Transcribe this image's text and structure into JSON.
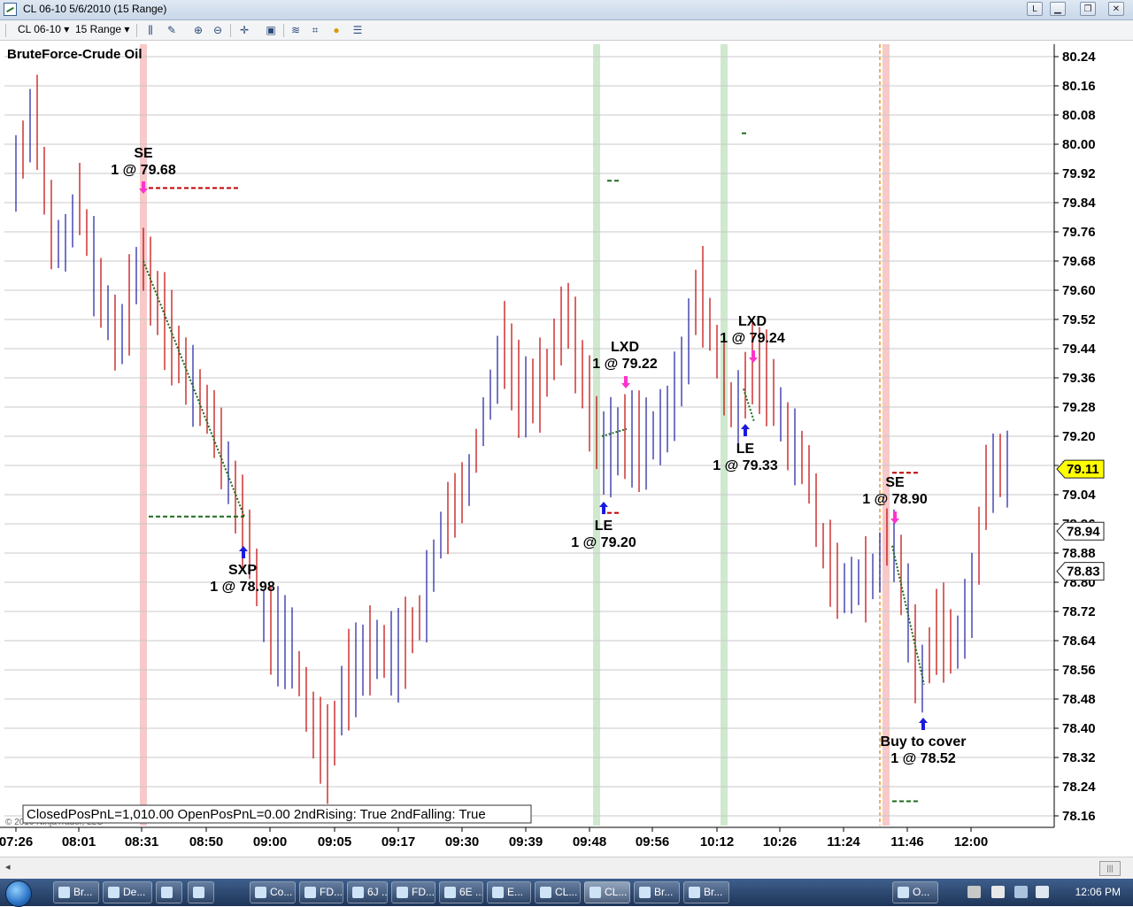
{
  "window": {
    "title": "CL 06-10  5/6/2010 (15 Range)",
    "btn_l": "L"
  },
  "toolbar": {
    "instrument": "CL 06-10",
    "interval": "15 Range"
  },
  "chart": {
    "title": "BruteForce-Crude Oil",
    "copyright": "© 2010 NinjaTrader, LLC",
    "status": "ClosedPosPnL=1,010.00 OpenPosPnL=0.00 2ndRising: True 2ndFalling: True",
    "last_price_tag": "79.11",
    "price_tag_2": "78.94",
    "price_tag_3": "78.83",
    "colors": {
      "up": "#1a1aa0",
      "down": "#c00000",
      "grid": "#c8c8c8",
      "short_band": "#f7c9c9",
      "long_band": "#cfe9cf",
      "label": "#000000",
      "tag_bg": "#ffff00"
    }
  },
  "chart_data": {
    "type": "ohlc",
    "y_ticks": [
      "80.24",
      "80.16",
      "80.08",
      "80.00",
      "79.92",
      "79.84",
      "79.76",
      "79.68",
      "79.60",
      "79.52",
      "79.44",
      "79.36",
      "79.28",
      "79.20",
      "79.12",
      "79.04",
      "78.96",
      "78.88",
      "78.80",
      "78.72",
      "78.64",
      "78.56",
      "78.48",
      "78.40",
      "78.32",
      "78.24",
      "78.16"
    ],
    "x_ticks": [
      "07:26",
      "08:01",
      "08:31",
      "08:50",
      "09:00",
      "09:05",
      "09:17",
      "09:30",
      "09:39",
      "09:48",
      "09:56",
      "10:12",
      "10:26",
      "11:24",
      "11:46",
      "12:00"
    ],
    "ylim": [
      78.16,
      80.24
    ],
    "markers": [
      {
        "name": "SE",
        "text": "1 @ 79.68",
        "price": 79.68,
        "kind": "short-entry"
      },
      {
        "name": "SXP",
        "text": "1 @ 78.98",
        "price": 78.98,
        "kind": "short-exit"
      },
      {
        "name": "LXD",
        "text": "1 @ 79.22",
        "price": 79.22,
        "kind": "long-exit"
      },
      {
        "name": "LE",
        "text": "1 @ 79.20",
        "price": 79.2,
        "kind": "long-entry"
      },
      {
        "name": "LXD",
        "text": "1 @ 79.24",
        "price": 79.24,
        "kind": "long-exit"
      },
      {
        "name": "LE",
        "text": "1 @ 79.33",
        "price": 79.33,
        "kind": "long-entry"
      },
      {
        "name": "SE",
        "text": "1 @ 78.90",
        "price": 78.9,
        "kind": "short-entry"
      },
      {
        "name": "Buy to cover",
        "text": "1 @ 78.52",
        "price": 78.52,
        "kind": "short-exit"
      }
    ]
  },
  "taskbar": {
    "clock": "12:06 PM",
    "buttons": [
      "Br...",
      "De...",
      "",
      "",
      "Co...",
      "FD...",
      "6J ...",
      "FD...",
      "6E ...",
      "E...",
      "CL...",
      "CL...",
      "Br...",
      "Br...",
      "O..."
    ]
  }
}
